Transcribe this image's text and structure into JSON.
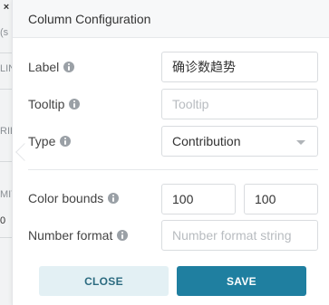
{
  "background": {
    "close_glyph": "×",
    "fragments": [
      "(s",
      "LIN",
      "RIB",
      "MIT",
      "0"
    ]
  },
  "popover": {
    "title": "Column Configuration",
    "label": {
      "text": "Label",
      "value": "确诊数趋势"
    },
    "tooltip": {
      "text": "Tooltip",
      "placeholder": "Tooltip"
    },
    "type": {
      "text": "Type",
      "value": "Contribution"
    },
    "color_bounds": {
      "text": "Color bounds",
      "min": "100",
      "max": "100"
    },
    "number_format": {
      "text": "Number format",
      "placeholder": "Number format string"
    },
    "buttons": {
      "close": "CLOSE",
      "save": "SAVE"
    }
  },
  "colors": {
    "primary": "#1f7fa0",
    "secondary_bg": "#e3f0f4",
    "secondary_text": "#2c6b80"
  },
  "icons": [
    "close-icon",
    "info-icon",
    "chevron-down-icon"
  ]
}
